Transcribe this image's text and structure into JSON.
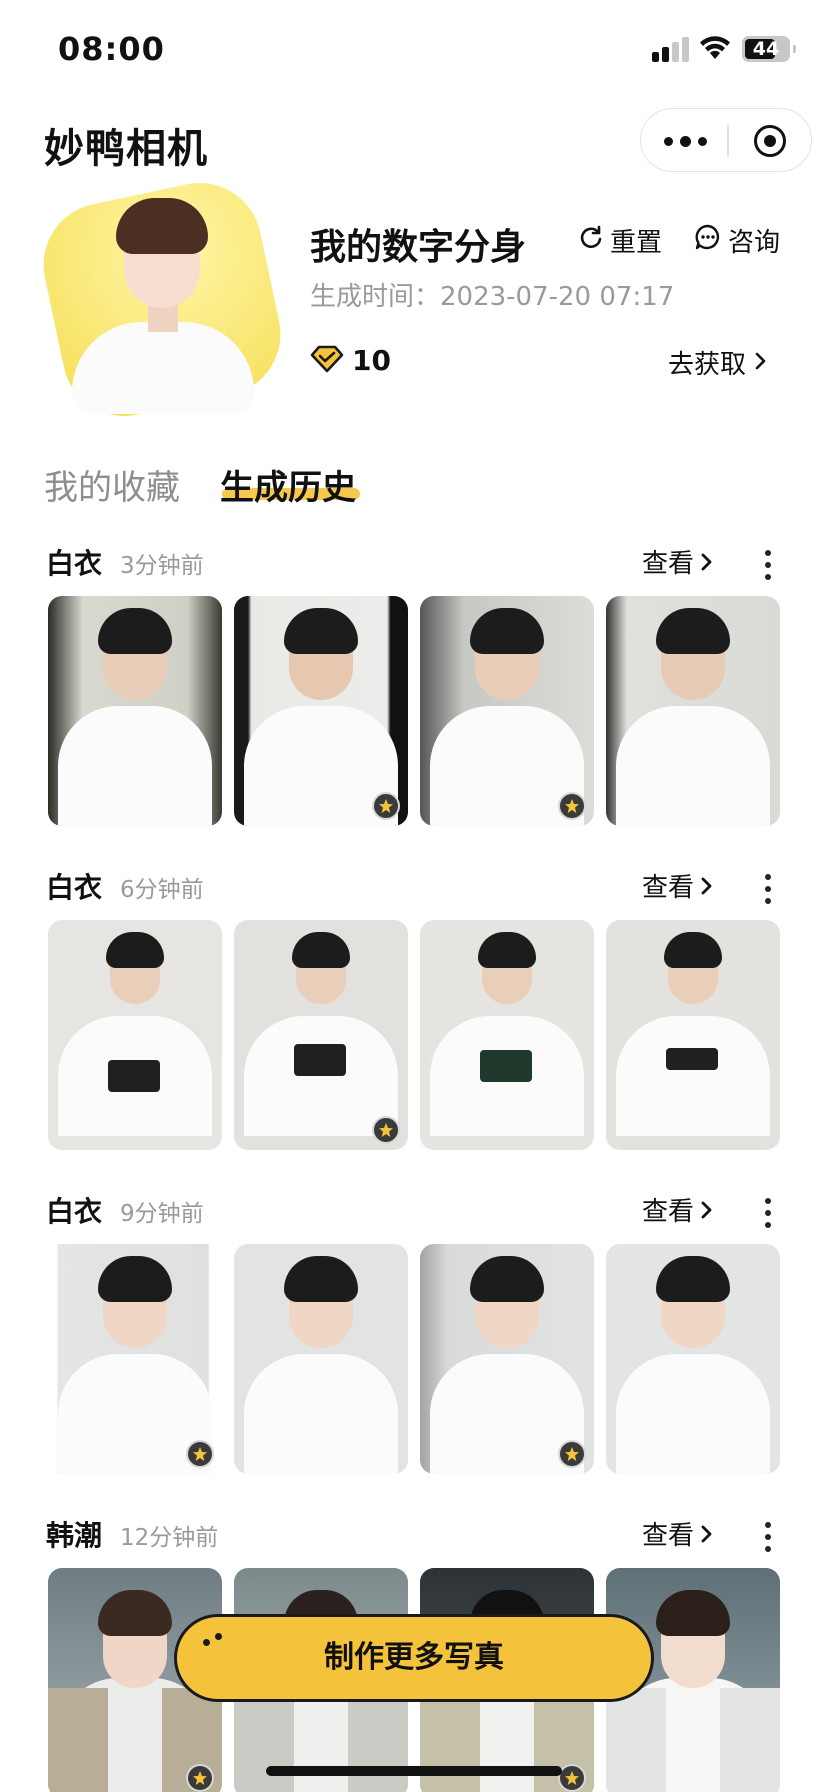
{
  "status_bar": {
    "time": "08:00",
    "battery": "44"
  },
  "header": {
    "app_title": "妙鸭相机"
  },
  "profile": {
    "name": "我的数字分身",
    "reset_label": "重置",
    "consult_label": "咨询",
    "generated_time": "生成时间：2023-07-20 07:17",
    "gem_count": "10",
    "get_more_label": "去获取"
  },
  "tabs": [
    {
      "label": "我的收藏",
      "active": false
    },
    {
      "label": "生成历史",
      "active": true
    }
  ],
  "groups": [
    {
      "name": "白衣",
      "time": "3分钟前",
      "view_label": "查看",
      "starred": [
        false,
        true,
        true,
        false
      ]
    },
    {
      "name": "白衣",
      "time": "6分钟前",
      "view_label": "查看",
      "starred": [
        false,
        true,
        false,
        false
      ]
    },
    {
      "name": "白衣",
      "time": "9分钟前",
      "view_label": "查看",
      "starred": [
        true,
        false,
        true,
        false
      ]
    },
    {
      "name": "韩潮",
      "time": "12分钟前",
      "view_label": "查看",
      "starred": [
        true,
        false,
        true,
        false
      ]
    }
  ],
  "fab": {
    "label": "制作更多写真"
  },
  "colors": {
    "accent": "#f5c33b",
    "muted_text": "#9a9a9a",
    "avatar_bg": "#f5dd52"
  },
  "icons": [
    "signal-icon",
    "wifi-icon",
    "battery-icon",
    "more-dots-icon",
    "target-icon",
    "refresh-icon",
    "chat-icon",
    "gem-icon",
    "chevron-right-icon",
    "vertical-dots-icon",
    "star-badge-icon"
  ]
}
